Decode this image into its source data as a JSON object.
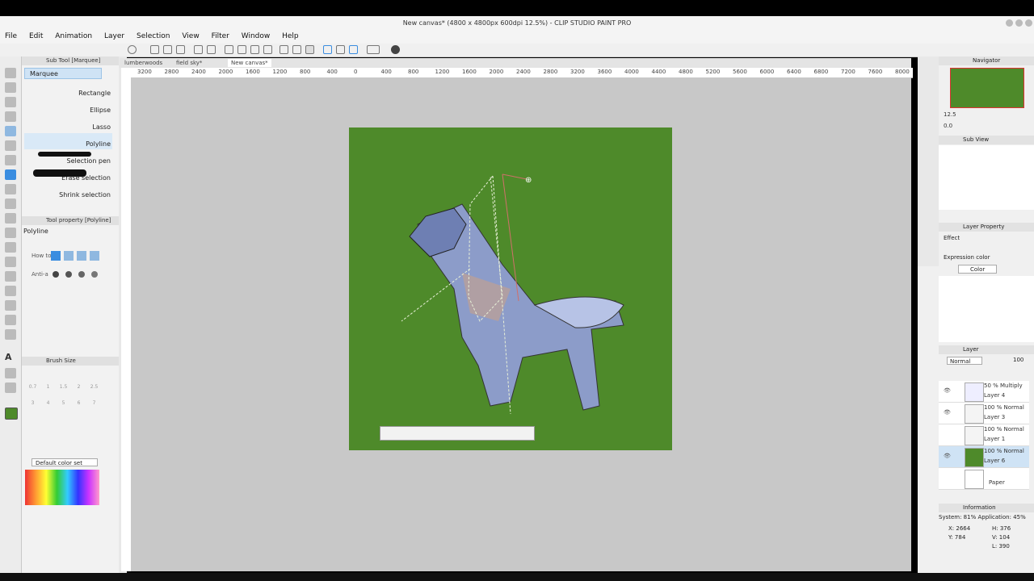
{
  "window": {
    "title": "New canvas* (4800 x 4800px 600dpi 12.5%) - CLIP STUDIO PAINT PRO"
  },
  "menu": [
    "File",
    "Edit",
    "Animation",
    "Layer",
    "Selection",
    "View",
    "Filter",
    "Window",
    "Help"
  ],
  "tabs": [
    "lumberwoods",
    "field sky*",
    "New canvas*"
  ],
  "subtool": {
    "header": "Sub Tool [Marquee]",
    "group": "Marquee",
    "items": [
      "Rectangle",
      "Ellipse",
      "Lasso",
      "Polyline",
      "Selection pen",
      "Erase selection",
      "Shrink selection"
    ]
  },
  "tool_property": {
    "header": "Tool property [Polyline]",
    "name": "Polyline",
    "how_label": "How to",
    "aa_label": "Anti-a"
  },
  "brush_size": {
    "header": "Brush Size",
    "values": [
      "0.7",
      "1",
      "1.5",
      "2",
      "2.5",
      "3",
      "4",
      "5",
      "6",
      "7"
    ]
  },
  "color_set": {
    "label": "Default color set"
  },
  "ruler_labels": [
    "3200",
    "2800",
    "2400",
    "2000",
    "1600",
    "1200",
    "800",
    "400",
    "0",
    "400",
    "800",
    "1200",
    "1600",
    "2000",
    "2400",
    "2800",
    "3200",
    "3600",
    "4000",
    "4400",
    "4800",
    "5200",
    "5600",
    "6000",
    "6400",
    "6800",
    "7200",
    "7600",
    "8000"
  ],
  "navigator": {
    "header": "Navigator",
    "zoom": "12.5",
    "angle": "0.0"
  },
  "subview": {
    "header": "Sub View"
  },
  "layer_property": {
    "header": "Layer Property",
    "effect": "Effect",
    "expression_label": "Expression color",
    "expression_value": "Color"
  },
  "layer_panel": {
    "header": "Layer",
    "blend": "Normal",
    "opacity": "100",
    "layers": [
      {
        "mode": "50 % Multiply",
        "name": "Layer 4"
      },
      {
        "mode": "100 % Normal",
        "name": "Layer 3"
      },
      {
        "mode": "100 % Normal",
        "name": "Layer 1"
      },
      {
        "mode": "100 % Normal",
        "name": "Layer 6"
      },
      {
        "mode": "",
        "name": "Paper"
      }
    ]
  },
  "information": {
    "header": "Information",
    "system": "System: 81% Application: 45%",
    "x": "X: 2664",
    "y": "Y: 784",
    "h": "H: 376",
    "v": "V: 104",
    "l": "L: 390"
  },
  "colors": {
    "canvas_bg": "#4e8a2a",
    "workspace": "#c8c8c8",
    "accent": "#3a8de0"
  }
}
